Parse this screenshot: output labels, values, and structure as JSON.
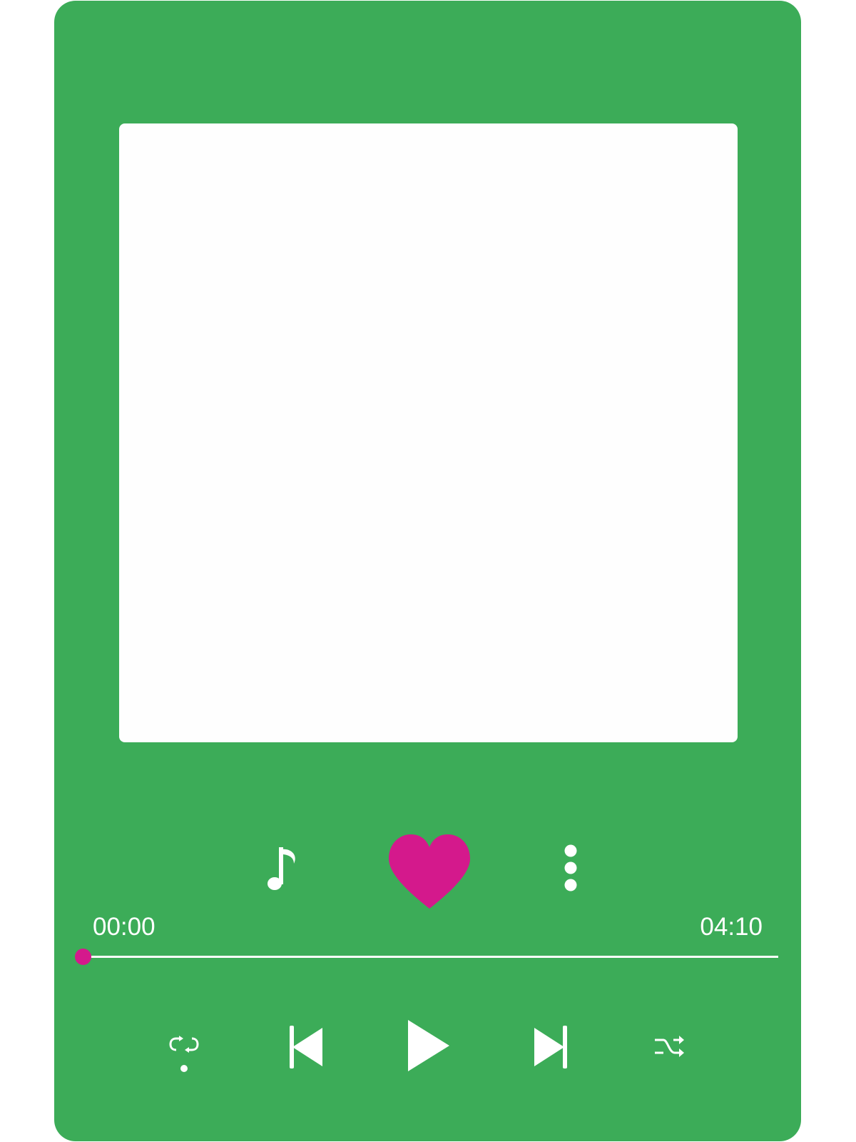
{
  "player": {
    "artwork": "blank-artwork",
    "actions": {
      "lyrics_icon": "music-note-icon",
      "like_icon": "heart-icon",
      "more_icon": "more-vertical-icon"
    },
    "progress": {
      "elapsed": "00:00",
      "total": "04:10",
      "fraction": 0.0
    },
    "controls": {
      "repeat_icon": "repeat-icon",
      "previous_icon": "skip-previous-icon",
      "play_icon": "play-icon",
      "next_icon": "skip-next-icon",
      "shuffle_icon": "shuffle-icon"
    }
  },
  "colors": {
    "background": "#3cac58",
    "artwork": "#fefefe",
    "accent": "#d4198c",
    "foreground": "#ffffff"
  }
}
